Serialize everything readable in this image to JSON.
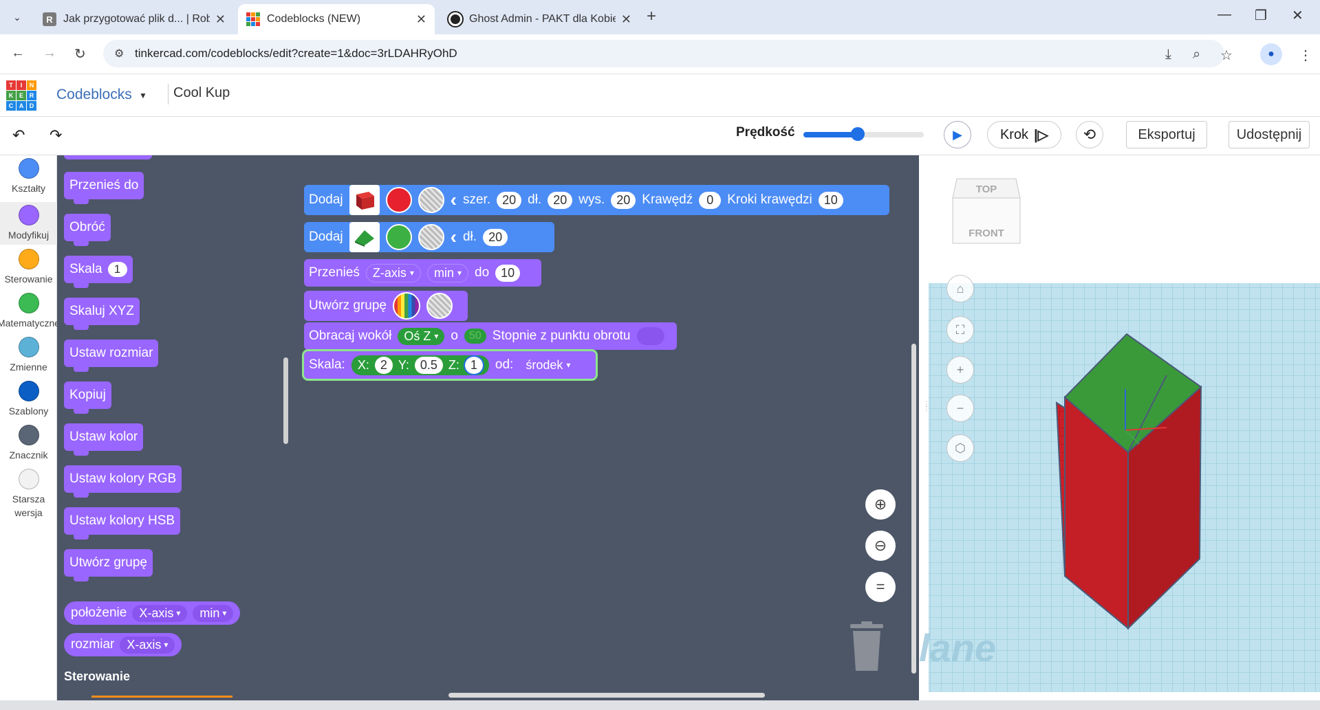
{
  "browser": {
    "tabs": [
      {
        "title": "Jak przygotować plik d... | Robis",
        "icon_color": "#7a7a7a"
      },
      {
        "title": "Codeblocks (NEW)",
        "icon_color": "#ff8c1a"
      },
      {
        "title": "Ghost Admin - PAKT dla Kobiet",
        "icon_color": "#222222"
      }
    ],
    "url": "tinkercad.com/codeblocks/edit?create=1&doc=3rLDAHRyOhD"
  },
  "app": {
    "logo_letters": [
      "T",
      "I",
      "N",
      "K",
      "E",
      "R",
      "C",
      "A",
      "D"
    ],
    "section": "Codeblocks",
    "project_name": "Cool Kup"
  },
  "toolbar": {
    "speed_label": "Prędkość",
    "speed_value": 0.45,
    "step_label": "Krok",
    "export_label": "Eksportuj",
    "share_label": "Udostępnij"
  },
  "categories": [
    {
      "label": "Kształty",
      "color": "#4c8cf5"
    },
    {
      "label": "Modyfikuj",
      "color": "#9966ff",
      "selected": true
    },
    {
      "label": "Sterowanie",
      "color": "#ffab19"
    },
    {
      "label": "Matematyczne",
      "color": "#3cba54"
    },
    {
      "label": "Zmienne",
      "color": "#5cb1d6"
    },
    {
      "label": "Szablony",
      "color": "#0b5ec4"
    },
    {
      "label": "Znacznik",
      "color": "#5a6575"
    },
    {
      "label": "Starsza wersja",
      "color": "#f2f2f2"
    }
  ],
  "flyout": {
    "blocks": [
      "Przenieś do",
      "Obróć",
      "Skala",
      "Skaluj XYZ",
      "Ustaw rozmiar",
      "Kopiuj",
      "Ustaw kolor",
      "Ustaw kolory RGB",
      "Ustaw kolory HSB",
      "Utwórz grupę"
    ],
    "scale_value": "1",
    "reporter_position": {
      "label": "położenie",
      "axis": "X-axis",
      "mode": "min"
    },
    "reporter_size": {
      "label": "rozmiar",
      "axis": "X-axis"
    },
    "section_heading": "Sterowanie"
  },
  "workspace": {
    "block1": {
      "label": "Dodaj",
      "shape": "cube",
      "color": "#e8212e",
      "w_label": "szer.",
      "w": "20",
      "l_label": "dł.",
      "l": "20",
      "h_label": "wys.",
      "h": "20",
      "edge_label": "Krawędź",
      "edge": "0",
      "steps_label": "Kroki krawędzi",
      "steps": "10"
    },
    "block2": {
      "label": "Dodaj",
      "shape": "roof",
      "color": "#3cb043",
      "l_label": "dł.",
      "l": "20"
    },
    "block3": {
      "label": "Przenieś",
      "axis": "Z-axis",
      "mode": "min",
      "to_label": "do",
      "value": "10"
    },
    "block4": {
      "label": "Utwórz grupę"
    },
    "block5": {
      "label": "Obracaj wokół",
      "axis": "Oś Z",
      "o": "o",
      "degrees": "50",
      "suffix": "Stopnie  z punktu obrotu"
    },
    "block6": {
      "label": "Skala:",
      "x_label": "X:",
      "x": "2",
      "y_label": "Y:",
      "y": "0.5",
      "z_label": "Z:",
      "z": "1",
      "from_label": "od:",
      "from": "środek"
    }
  },
  "viewport": {
    "cube_top": "TOP",
    "cube_front": "FRONT",
    "watermark": "lane",
    "top_color": "#3a9a3a",
    "side_color": "#cc1f27"
  }
}
